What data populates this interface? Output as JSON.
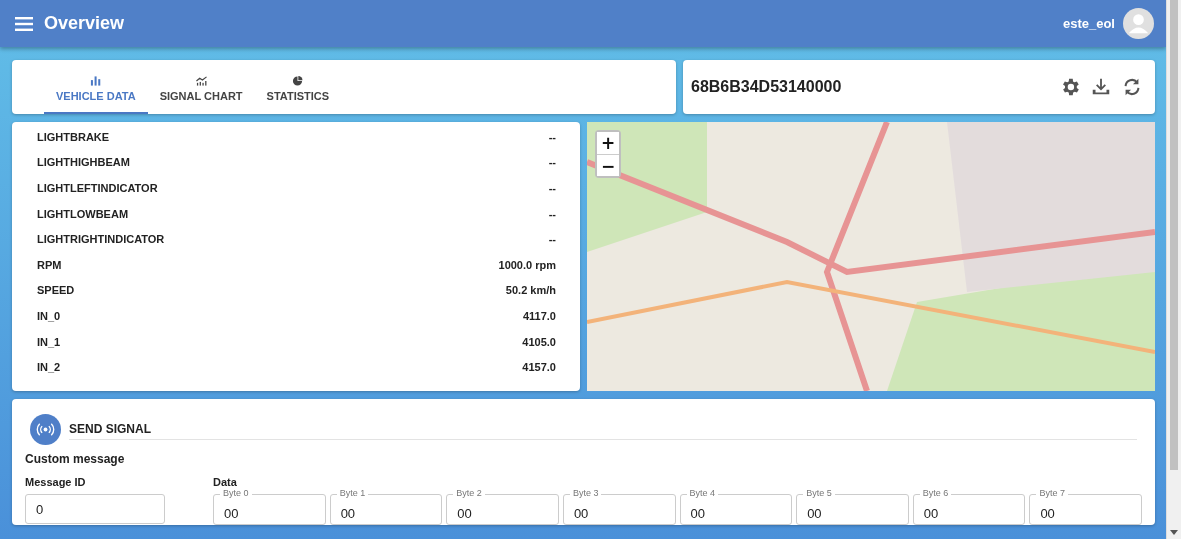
{
  "header": {
    "title": "Overview",
    "user": "este_eol"
  },
  "tabs": [
    {
      "label": "VEHICLE DATA",
      "kind": "bars",
      "selected": true
    },
    {
      "label": "SIGNAL CHART",
      "kind": "line",
      "selected": false
    },
    {
      "label": "STATISTICS",
      "kind": "pie",
      "selected": false
    }
  ],
  "device": {
    "id": "68B6B34D53140000"
  },
  "signals": [
    {
      "name": "LIGHTBRAKE",
      "value": "--"
    },
    {
      "name": "LIGHTHIGHBEAM",
      "value": "--"
    },
    {
      "name": "LIGHTLEFTINDICATOR",
      "value": "--"
    },
    {
      "name": "LIGHTLOWBEAM",
      "value": "--"
    },
    {
      "name": "LIGHTRIGHTINDICATOR",
      "value": "--"
    },
    {
      "name": "RPM",
      "value": "1000.0 rpm"
    },
    {
      "name": "SPEED",
      "value": "50.2 km/h"
    },
    {
      "name": "IN_0",
      "value": "4117.0"
    },
    {
      "name": "IN_1",
      "value": "4105.0"
    },
    {
      "name": "IN_2",
      "value": "4157.0"
    }
  ],
  "map": {
    "zoom_in": "+",
    "zoom_out": "−"
  },
  "send_signal": {
    "title": "SEND SIGNAL",
    "subtitle": "Custom message",
    "message_id": {
      "label": "Message ID",
      "value": "0"
    },
    "data_label": "Data",
    "bytes": [
      {
        "label": "Byte 0",
        "value": "00"
      },
      {
        "label": "Byte 1",
        "value": "00"
      },
      {
        "label": "Byte 2",
        "value": "00"
      },
      {
        "label": "Byte 3",
        "value": "00"
      },
      {
        "label": "Byte 4",
        "value": "00"
      },
      {
        "label": "Byte 5",
        "value": "00"
      },
      {
        "label": "Byte 6",
        "value": "00"
      },
      {
        "label": "Byte 7",
        "value": "00"
      }
    ]
  }
}
